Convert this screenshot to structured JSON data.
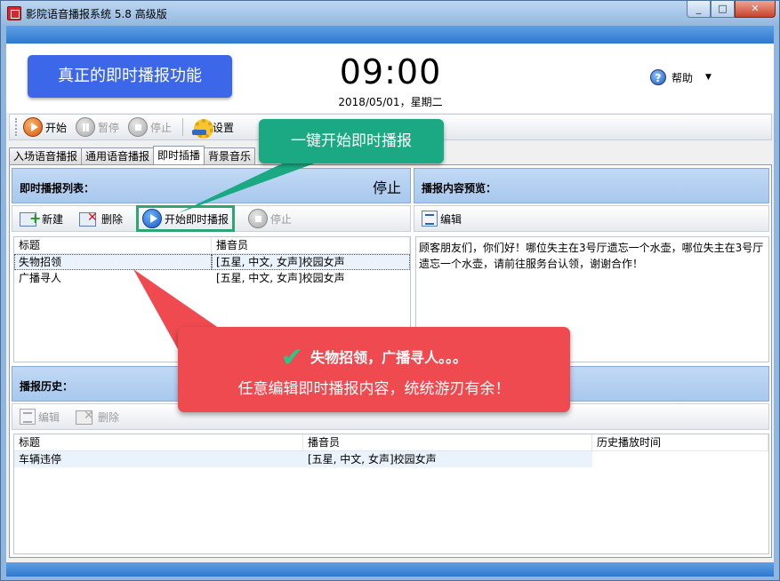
{
  "window": {
    "title": "影院语音播报系统 5.8 高级版",
    "controls": {
      "minimize": "_",
      "maximize": "□",
      "close": "✕"
    }
  },
  "header": {
    "promo": "真正的即时播报功能",
    "time": "09:00",
    "date": "2018/05/01，星期二",
    "help_label": "帮助",
    "help_caret": "▼"
  },
  "toolbar": {
    "start": "开始",
    "pause": "暂停",
    "stop": "停止",
    "settings": "设置"
  },
  "tabs": [
    "入场语音播报",
    "通用语音播报",
    "即时插播",
    "背景音乐"
  ],
  "instant_list": {
    "title": "即时播报列表：",
    "status": "停止",
    "new": "新建",
    "delete": "删除",
    "start_instant": "开始即时播报",
    "stop": "停止",
    "columns": [
      "标题",
      "播音员"
    ],
    "rows": [
      {
        "title": "失物招领",
        "announcer": "[五星, 中文, 女声]校园女声"
      },
      {
        "title": "广播寻人",
        "announcer": "[五星, 中文, 女声]校园女声"
      }
    ]
  },
  "preview": {
    "title": "播报内容预览：",
    "edit": "编辑",
    "content": "顾客朋友们，你们好！哪位失主在3号厅遗忘一个水壶，哪位失主在3号厅遗忘一个水壶，请前往服务台认领，谢谢合作！"
  },
  "history": {
    "title": "播报历史：",
    "edit": "编辑",
    "delete": "删除",
    "columns": [
      "标题",
      "播音员",
      "历史播放时间"
    ],
    "rows": [
      {
        "title": "车辆违停",
        "announcer": "[五星, 中文, 女声]校园女声",
        "time": ""
      }
    ]
  },
  "callouts": {
    "green": "一键开始即时播报",
    "red_line1": "失物招领，广播寻人。。。",
    "red_line2": "任意编辑即时播报内容，统统游刃有余！",
    "check": "✔"
  },
  "colors": {
    "promo": "#3b67e8",
    "callout_green": "#1aa982",
    "callout_red": "#ee4a4f",
    "titlebar_blue": "#2e78cc"
  }
}
